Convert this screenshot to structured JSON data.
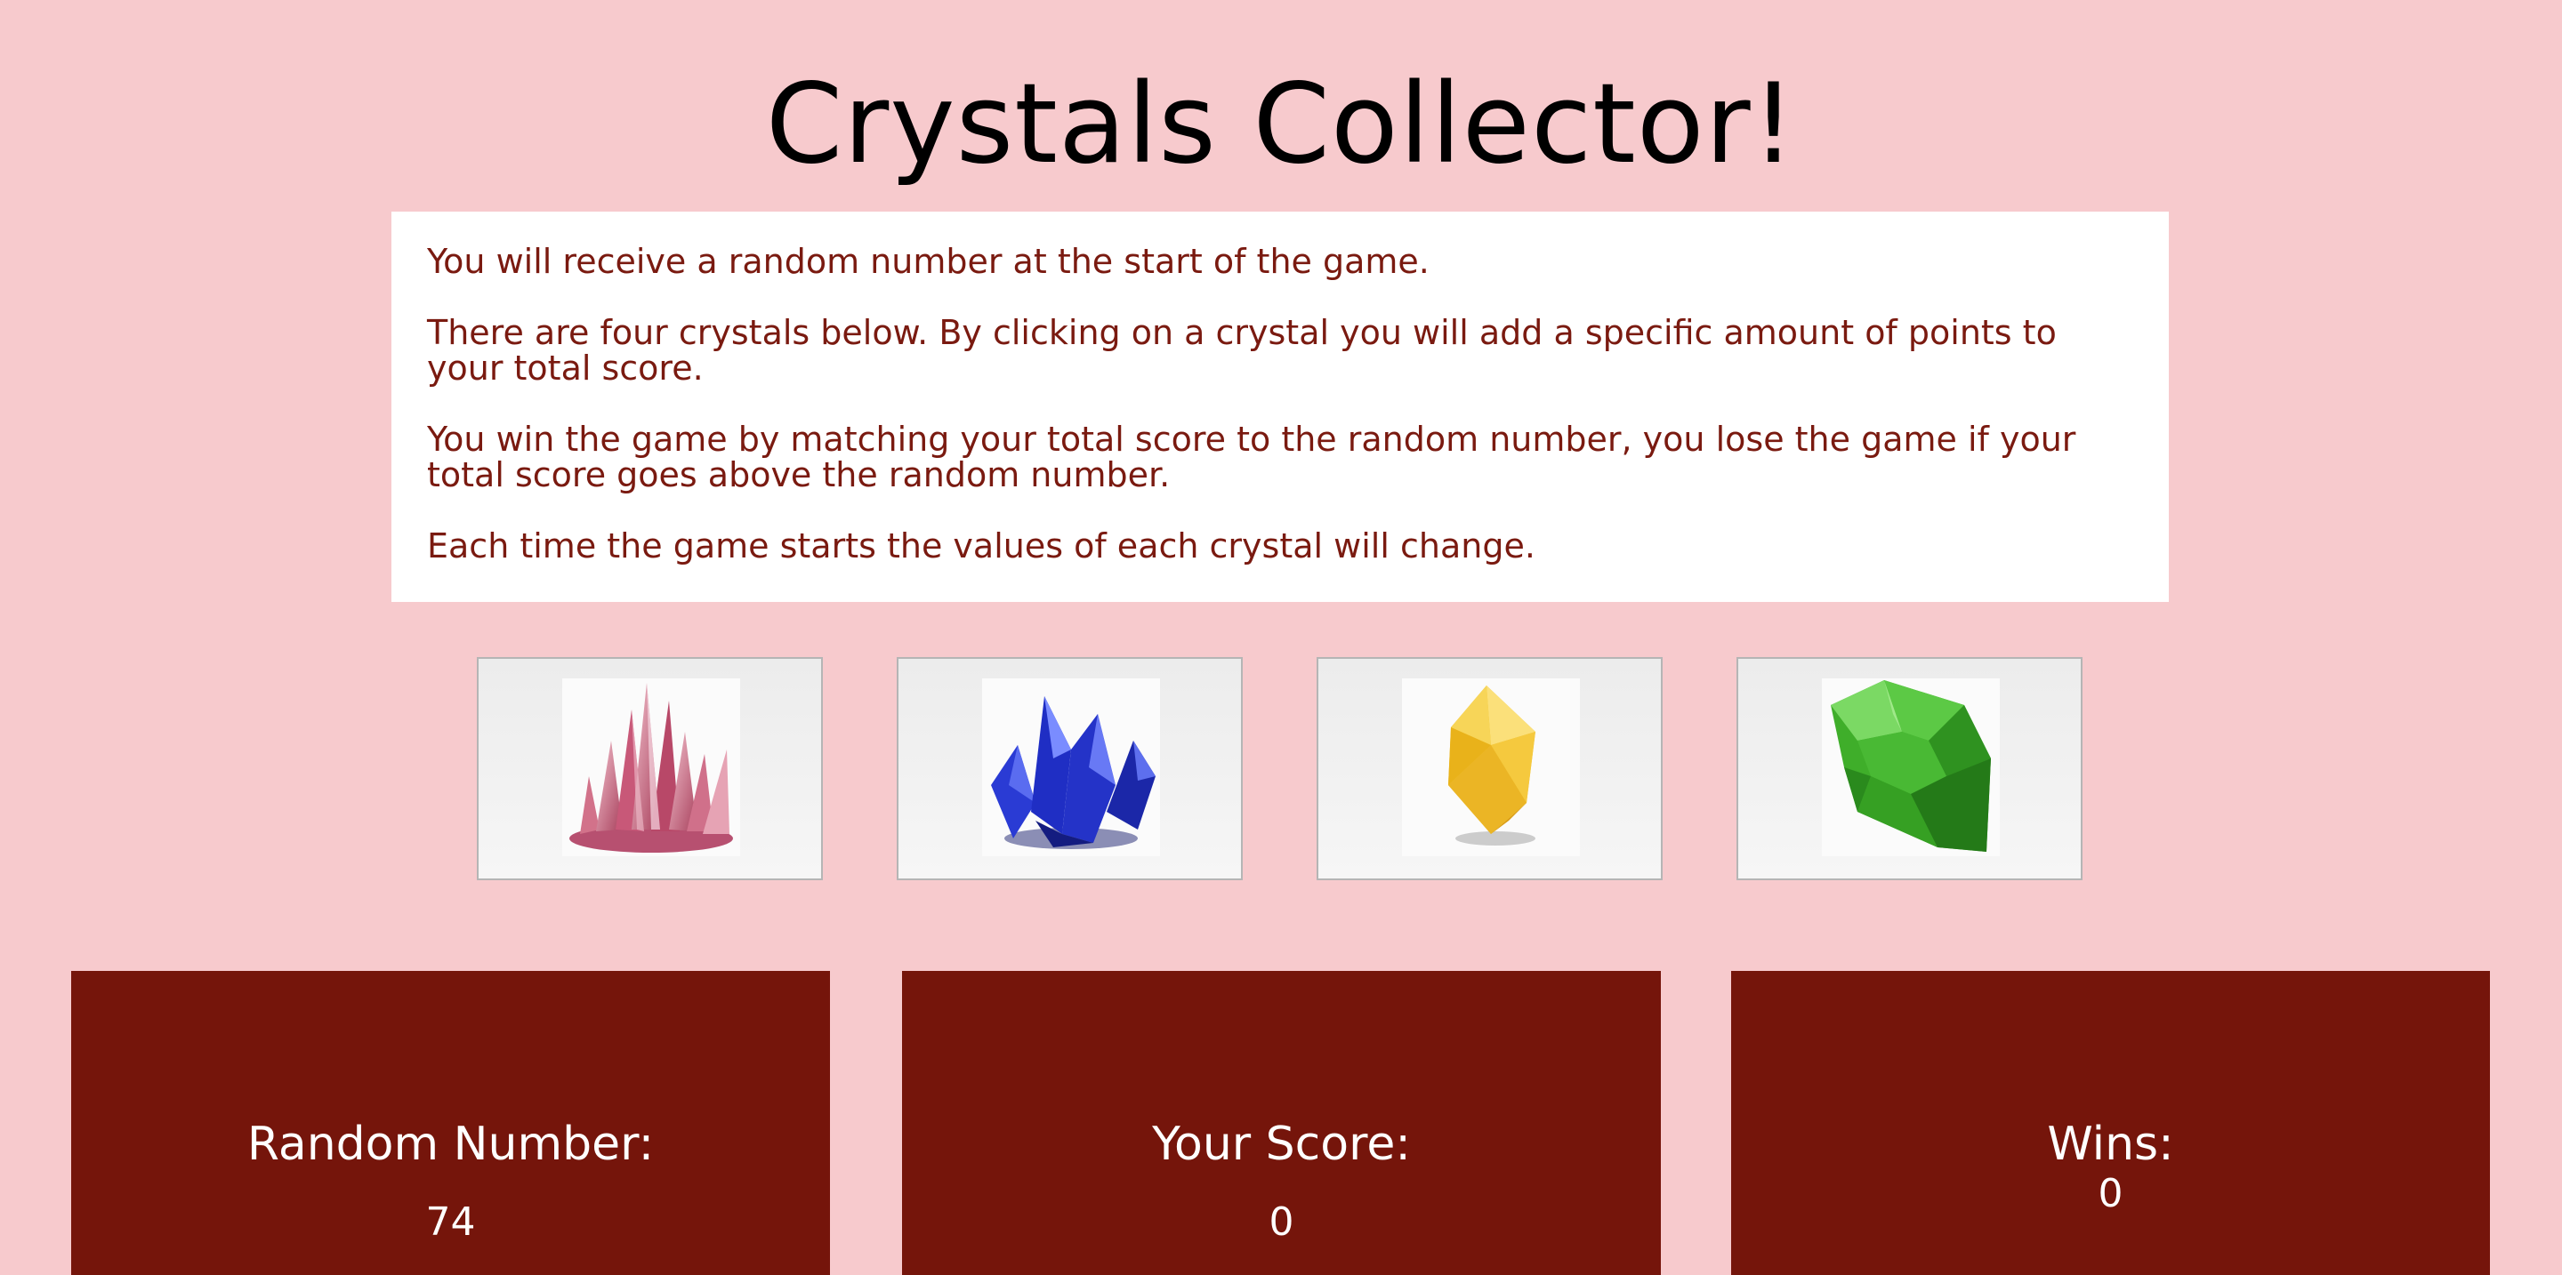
{
  "title": "Crystals Collector!",
  "instructions": [
    "You will receive a random number at the start of the game.",
    "There are four crystals below. By clicking on a crystal you will add a specific amount of points to your total score.",
    "You win the game by matching your total score to the random number, you lose the game if your total score goes above the random number.",
    "Each time the game starts the values of each crystal will change."
  ],
  "crystals": [
    {
      "icon": "pink-crystal-icon",
      "color": "#c0526e"
    },
    {
      "icon": "blue-crystal-icon",
      "color": "#2a3bd4"
    },
    {
      "icon": "yellow-crystal-icon",
      "color": "#f2c230"
    },
    {
      "icon": "green-crystal-icon",
      "color": "#3fae2a"
    }
  ],
  "scoreboard": {
    "random_label": "Random Number:",
    "random_value": "74",
    "score_label": "Your Score:",
    "score_value": "0",
    "wins_label": "Wins:",
    "wins_value": "0"
  },
  "colors": {
    "background": "#f7cacd",
    "panel_text": "#7a1a10",
    "score_panel": "#75150b"
  }
}
